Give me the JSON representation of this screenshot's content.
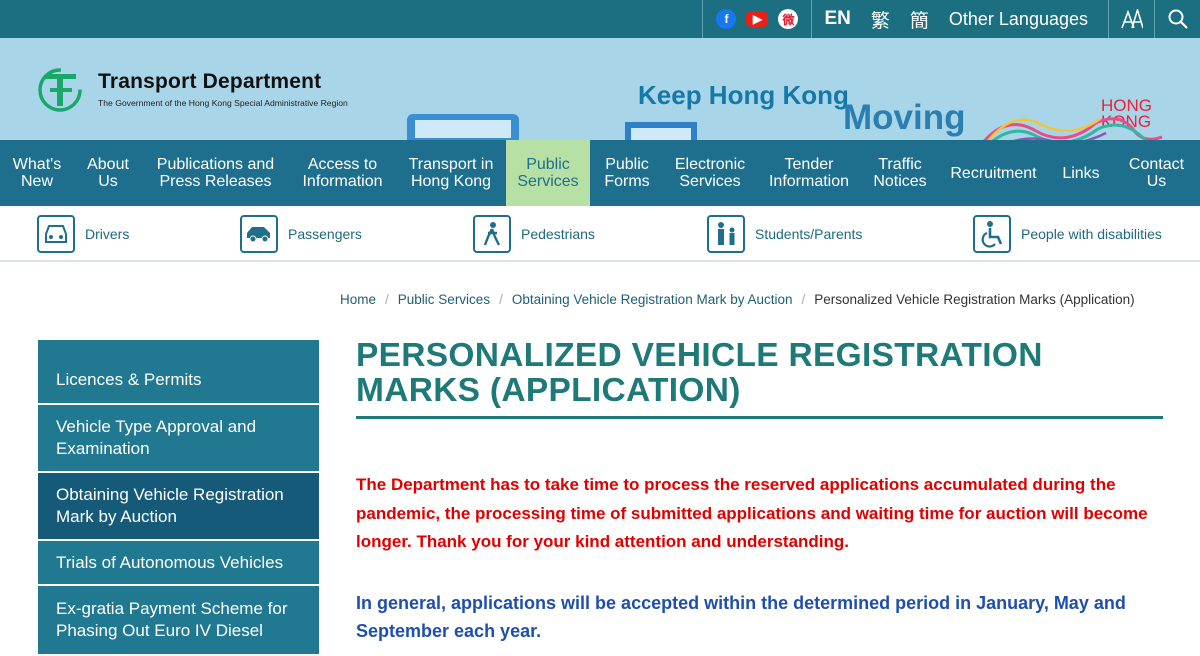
{
  "topbar": {
    "social": [
      "facebook-icon",
      "youtube-icon",
      "weibo-icon"
    ],
    "lang_en": "EN",
    "lang_tc": "繁",
    "lang_sc": "簡",
    "other_languages": "Other Languages",
    "font_size_label": "A",
    "search_label": "⌕"
  },
  "header": {
    "dept_name": "Transport Department",
    "gov_name": "The Government of the Hong Kong Special Administrative Region",
    "slogan_line1": "Keep Hong Kong",
    "slogan_line2": "Moving",
    "hk_brand_line1": "HONG",
    "hk_brand_line2": "KONG"
  },
  "nav": {
    "items": [
      {
        "label": "What's New"
      },
      {
        "label": "About Us"
      },
      {
        "label": "Publications and Press Releases"
      },
      {
        "label": "Access to Information"
      },
      {
        "label": "Transport in Hong Kong"
      },
      {
        "label": "Public Services"
      },
      {
        "label": "Public Forms"
      },
      {
        "label": "Electronic Services"
      },
      {
        "label": "Tender Information"
      },
      {
        "label": "Traffic Notices"
      },
      {
        "label": "Recruitment"
      },
      {
        "label": "Links"
      },
      {
        "label": "Contact Us"
      }
    ]
  },
  "audience": {
    "items": [
      {
        "label": "Drivers",
        "icon": "car-front-icon"
      },
      {
        "label": "Passengers",
        "icon": "car-side-icon"
      },
      {
        "label": "Pedestrians",
        "icon": "pedestrian-icon"
      },
      {
        "label": "Students/Parents",
        "icon": "family-icon"
      },
      {
        "label": "People with disabilities",
        "icon": "wheelchair-icon"
      }
    ]
  },
  "breadcrumb": {
    "items": [
      "Home",
      "Public Services",
      "Obtaining Vehicle Registration Mark by Auction"
    ],
    "current": "Personalized Vehicle Registration Marks (Application)",
    "separator": "/"
  },
  "sidebar": {
    "items": [
      {
        "label": "Licences & Permits"
      },
      {
        "label": "Vehicle Type Approval and Examination"
      },
      {
        "label": "Obtaining Vehicle Registration Mark by Auction"
      },
      {
        "label": "Trials of Autonomous Vehicles"
      },
      {
        "label": "Ex-gratia Payment Scheme for Phasing Out Euro IV Diesel"
      }
    ]
  },
  "main": {
    "title": "PERSONALIZED VEHICLE REGISTRATION MARKS (APPLICATION)",
    "notice_red": "The Department has to take time to process the reserved applications accumulated during the pandemic, the processing time of submitted applications and waiting time for auction will become longer. Thank you for your kind attention and understanding.",
    "notice_blue": "In general, applications will be accepted within the determined period in January, May and September each year."
  },
  "colors": {
    "topbar_bg": "#1b6f80",
    "header_bg": "#a9d5e8",
    "nav_bg": "#1e6f8e",
    "nav_active_bg": "#b7e0a4",
    "title_color": "#1e7a78",
    "red_text": "#e00000",
    "blue_text": "#1f4fae"
  }
}
